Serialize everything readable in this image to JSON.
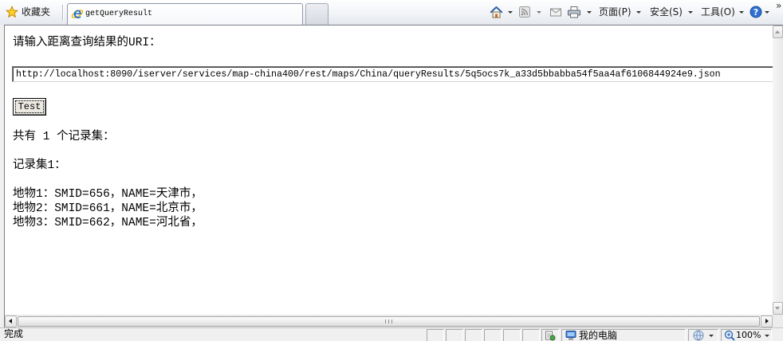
{
  "browser": {
    "favorites": {
      "label": "收藏夹",
      "icon": "star-icon"
    },
    "tabs": [
      {
        "title": "getQueryResult",
        "icon": "ie-page-icon"
      }
    ],
    "command_bar": {
      "icons": [
        "home-icon",
        "feeds-icon",
        "read-mail-icon",
        "print-icon",
        "help-icon"
      ],
      "page_label": "页面(P)",
      "safety_label": "安全(S)",
      "tools_label": "工具(O)",
      "help_glyph": "?",
      "overflow_glyph": "»"
    }
  },
  "page": {
    "prompt": "请输入距离查询结果的URI：",
    "uri_input": {
      "value": "http://localhost:8090/iserver/services/map-china400/rest/maps/China/queryResults/5q5ocs7k_a33d5bbabba54f5aa4af6106844924e9.json"
    },
    "test_button_label": "Test",
    "summary": "共有 1 个记录集：",
    "recordsets": [
      {
        "title": "记录集1：",
        "features": [
          "地物1：SMID=656，NAME=天津市，",
          "地物2：SMID=661，NAME=北京市，",
          "地物3：SMID=662，NAME=河北省，"
        ]
      }
    ]
  },
  "status_bar": {
    "text": "完成",
    "zone_icon": "computer-icon",
    "zone_label": "我的电脑",
    "zoom_icon": "zoom-icon",
    "zoom_label": "100%"
  },
  "colors": {
    "content_background": "#ffffff",
    "chrome_background": "#f0f0f0",
    "text": "#000000",
    "ie_blue": "#1b6dc9",
    "favorites_star": "#ffd21f"
  }
}
